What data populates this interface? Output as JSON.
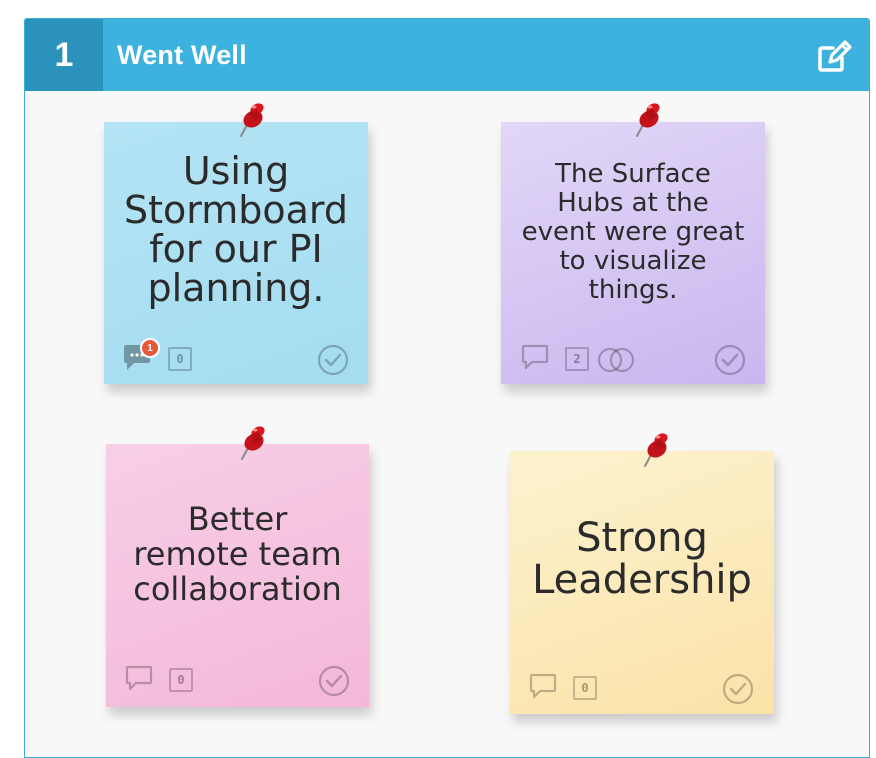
{
  "section": {
    "number": "1",
    "title": "Went Well",
    "edit_icon": "edit-icon",
    "accent_color": "#3db2df",
    "number_bg": "#2b92bb"
  },
  "notes": [
    {
      "text_lines": [
        "Using",
        "Stormboard",
        "for our PI",
        "planning."
      ],
      "color_top": "#b4e4f5",
      "color_bottom": "#a4dcf0",
      "comment_badge": "1",
      "vote_count": "0",
      "icons": [
        "comment-icon",
        "vote-count-icon",
        "check-icon"
      ]
    },
    {
      "text_lines": [
        "The Surface",
        "Hubs at the",
        "event were great",
        "to visualize",
        "things."
      ],
      "color_top": "#e2d7f7",
      "color_bottom": "#c9b6ef",
      "vote_count": "2",
      "icons": [
        "comment-icon",
        "vote-count-icon",
        "link-icon",
        "check-icon"
      ]
    },
    {
      "text_lines": [
        "Better",
        "remote team",
        "collaboration"
      ],
      "color_top": "#f8cfe6",
      "color_bottom": "#f3b7d9",
      "vote_count": "0",
      "icons": [
        "comment-icon",
        "vote-count-icon",
        "check-icon"
      ]
    },
    {
      "text_lines": [
        "Strong",
        "Leadership"
      ],
      "color_top": "#fdf2cf",
      "color_bottom": "#fbe3a8",
      "vote_count": "0",
      "icons": [
        "comment-icon",
        "vote-count-icon",
        "check-icon"
      ]
    }
  ]
}
